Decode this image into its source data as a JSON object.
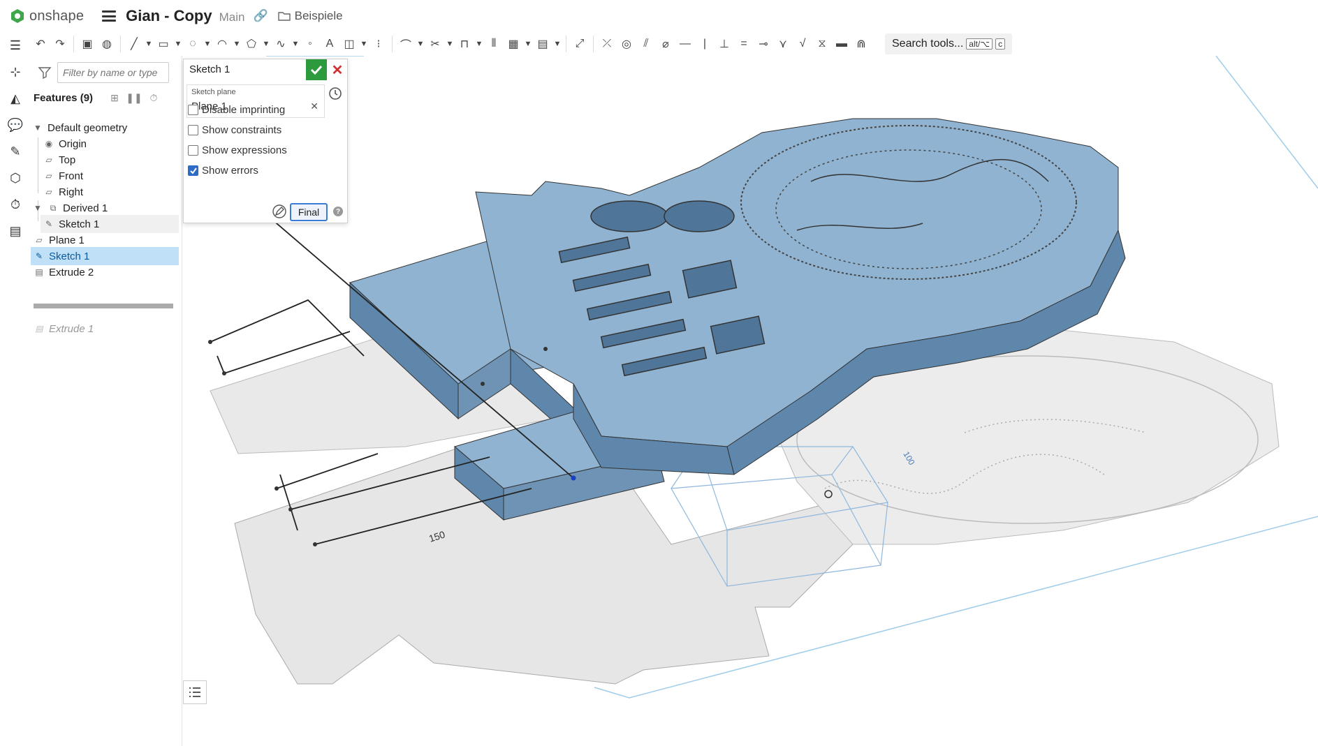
{
  "header": {
    "brand": "onshape",
    "document_title": "Gian - Copy",
    "workspace": "Main",
    "folder": "Beispiele"
  },
  "search_tools": {
    "label": "Search tools...",
    "shortcut_mod": "alt/⌥",
    "shortcut_key": "c"
  },
  "feature_panel": {
    "filter_placeholder": "Filter by name or type",
    "features_title": "Features (9)",
    "tree": {
      "default_geometry": "Default geometry",
      "origin": "Origin",
      "top": "Top",
      "front": "Front",
      "right": "Right",
      "derived": "Derived 1",
      "derived_sketch": "Sketch 1",
      "plane1": "Plane 1",
      "sketch1": "Sketch 1",
      "extrude2": "Extrude 2",
      "extrude1": "Extrude 1"
    }
  },
  "sketch_dialog": {
    "title": "Sketch 1",
    "plane_label": "Sketch plane",
    "plane_value": "Plane 1",
    "options": [
      {
        "label": "Disable imprinting",
        "checked": false
      },
      {
        "label": "Show constraints",
        "checked": false
      },
      {
        "label": "Show expressions",
        "checked": false
      },
      {
        "label": "Show errors",
        "checked": true
      }
    ],
    "final_label": "Final"
  },
  "viewport": {
    "dimension_1": "150",
    "dimension_2": "100"
  },
  "colors": {
    "solid_top": "#8fb3d1",
    "solid_side": "#5e87ab",
    "sketch_fill": "#e6e6e6",
    "plane_line": "#9fcdea",
    "accent_green": "#2d9a3d",
    "select_blue": "#bfe0f7"
  }
}
